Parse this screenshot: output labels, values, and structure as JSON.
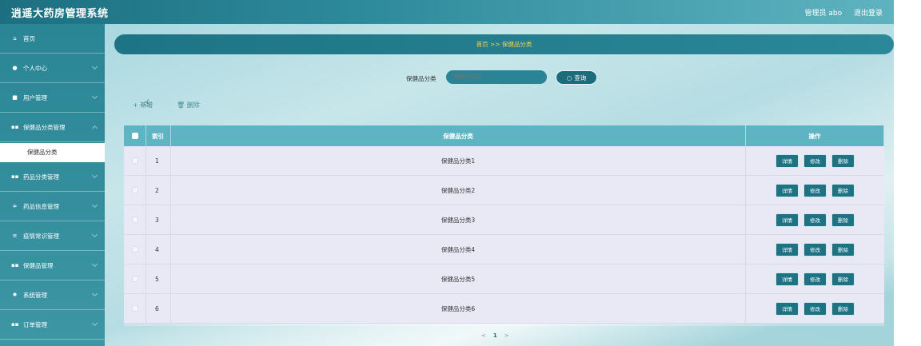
{
  "app": {
    "title": "逍遥大药房管理系统"
  },
  "user": {
    "greeting": "管理员 abo",
    "logout": "退出登录"
  },
  "sidebar": {
    "items": [
      {
        "icon": "home-icon",
        "label": "首页"
      },
      {
        "icon": "user-icon",
        "label": "个人中心"
      },
      {
        "icon": "users-icon",
        "label": "用户管理"
      },
      {
        "icon": "grid-icon",
        "label": "保健品分类管理"
      },
      {
        "icon": "grid-icon",
        "label": "药品分类管理"
      },
      {
        "icon": "sliders-icon",
        "label": "药品信息管理"
      },
      {
        "icon": "list-icon",
        "label": "疫情常识管理"
      },
      {
        "icon": "grid-icon",
        "label": "保健品管理"
      },
      {
        "icon": "gear-icon",
        "label": "系统管理"
      },
      {
        "icon": "grid-icon",
        "label": "订单管理"
      }
    ],
    "submenu": {
      "label": "保健品分类"
    }
  },
  "breadcrumb": {
    "text": "首页 >> 保健品分类"
  },
  "search": {
    "label": "保健品分类",
    "placeholder": "保健品分类",
    "button": "查询"
  },
  "toolbar": {
    "add": "+ 新增",
    "delete": "删除"
  },
  "table": {
    "headers": {
      "index": "索引",
      "name": "保健品分类",
      "ops": "操作"
    },
    "rows": [
      {
        "index": "1",
        "name": "保健品分类1"
      },
      {
        "index": "2",
        "name": "保健品分类2"
      },
      {
        "index": "3",
        "name": "保健品分类3"
      },
      {
        "index": "4",
        "name": "保健品分类4"
      },
      {
        "index": "5",
        "name": "保健品分类5"
      },
      {
        "index": "6",
        "name": "保健品分类6"
      }
    ],
    "actions": {
      "detail": "详情",
      "edit": "修改",
      "delete": "删除"
    }
  },
  "pagination": {
    "prev": "<",
    "current": "1",
    "next": ">"
  },
  "colors": {
    "accent": "#1d7384",
    "breadcrumb_text": "#f3d44b",
    "header_bg": "#5fb4c4",
    "row_bg": "#e9e9f6"
  }
}
